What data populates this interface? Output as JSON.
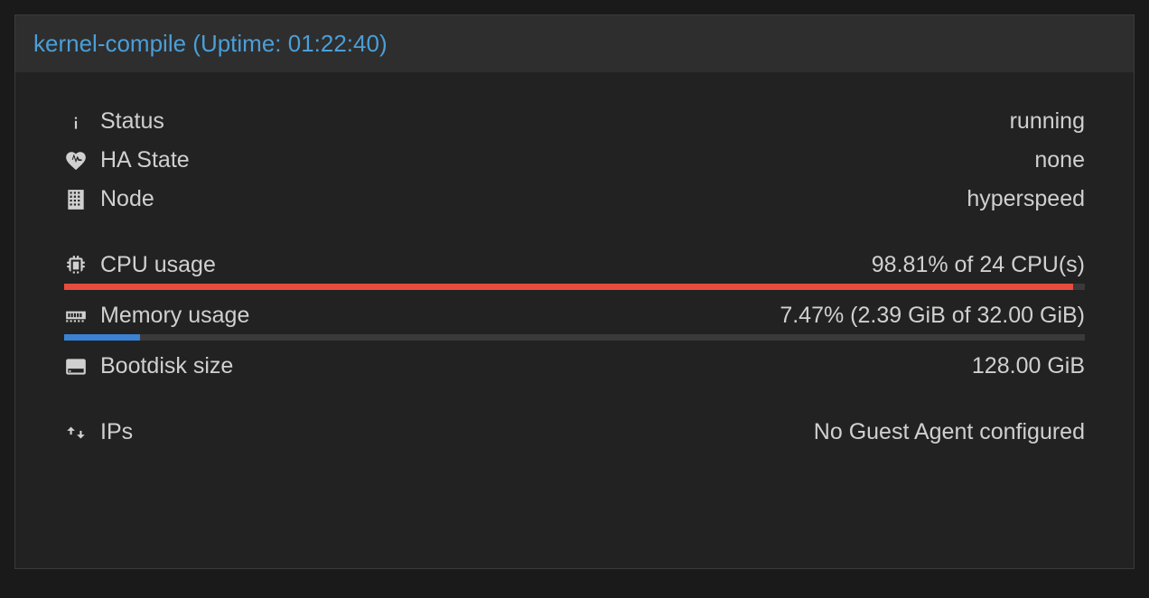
{
  "header": {
    "title": "kernel-compile (Uptime: 01:22:40)"
  },
  "status": {
    "label": "Status",
    "value": "running"
  },
  "ha_state": {
    "label": "HA State",
    "value": "none"
  },
  "node": {
    "label": "Node",
    "value": "hyperspeed"
  },
  "cpu": {
    "label": "CPU usage",
    "value": "98.81% of 24 CPU(s)",
    "percent": "98.81"
  },
  "memory": {
    "label": "Memory usage",
    "value": "7.47% (2.39 GiB of 32.00 GiB)",
    "percent": "7.47"
  },
  "bootdisk": {
    "label": "Bootdisk size",
    "value": "128.00 GiB"
  },
  "ips": {
    "label": "IPs",
    "value": "No Guest Agent configured"
  }
}
